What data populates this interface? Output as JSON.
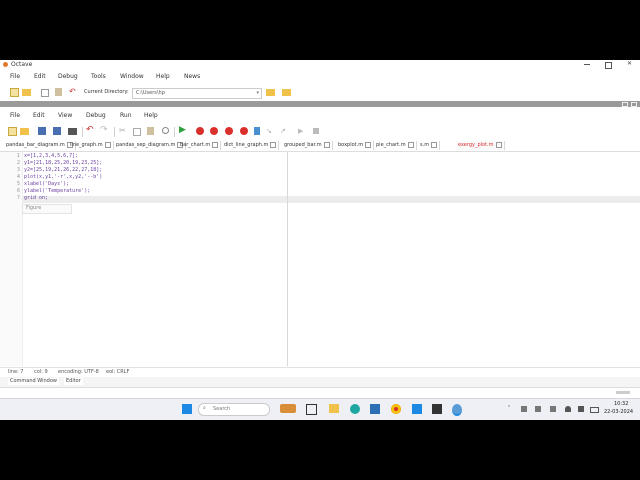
{
  "app": {
    "title": "Octave"
  },
  "menu": [
    "File",
    "Edit",
    "Debug",
    "Tools",
    "Window",
    "Help",
    "News"
  ],
  "toolbar": {
    "dir_label": "Current Directory:",
    "dir_value": "C:\\Users\\hp"
  },
  "editor": {
    "menu": [
      "File",
      "Edit",
      "View",
      "Debug",
      "Run",
      "Help"
    ],
    "tabs": [
      "pandas_bar_diagram.m",
      "line_graph.m",
      "pandas_sep_diagram.m",
      "bar_chart.m",
      "dict_line_graph.m",
      "grouped_bar.m",
      "boxplot.m",
      "pie_chart.m",
      "s.m",
      "exergy_plot.m"
    ],
    "lines": [
      "x=[1,2,3,4,5,6,7];",
      "y1=[21,18,25,20,19,23,25];",
      "y2=[25,19,21,26,22,27,18];",
      "plot(x,y1,'-r',x,y2,'--b')",
      "xlabel('Days');",
      "ylabel('Temperature');",
      "grid on;"
    ],
    "line_numbers": [
      "1",
      "2",
      "3",
      "4",
      "5",
      "6",
      "7"
    ],
    "bottom_tabs": [
      "Figure"
    ],
    "status": [
      "line: 7",
      "col: 9",
      "encoding: UTF-8",
      "eol: CRLF"
    ]
  },
  "panel_tabs": [
    "Command Window",
    "Editor"
  ],
  "taskbar": {
    "search_placeholder": "Search",
    "time": "10:32",
    "date": "22-03-2024"
  },
  "colors": {
    "accent": "#1e88e5",
    "chrome": "#f0f0f0",
    "run_green": "#2e9e3e",
    "stop_red": "#d9302c"
  }
}
